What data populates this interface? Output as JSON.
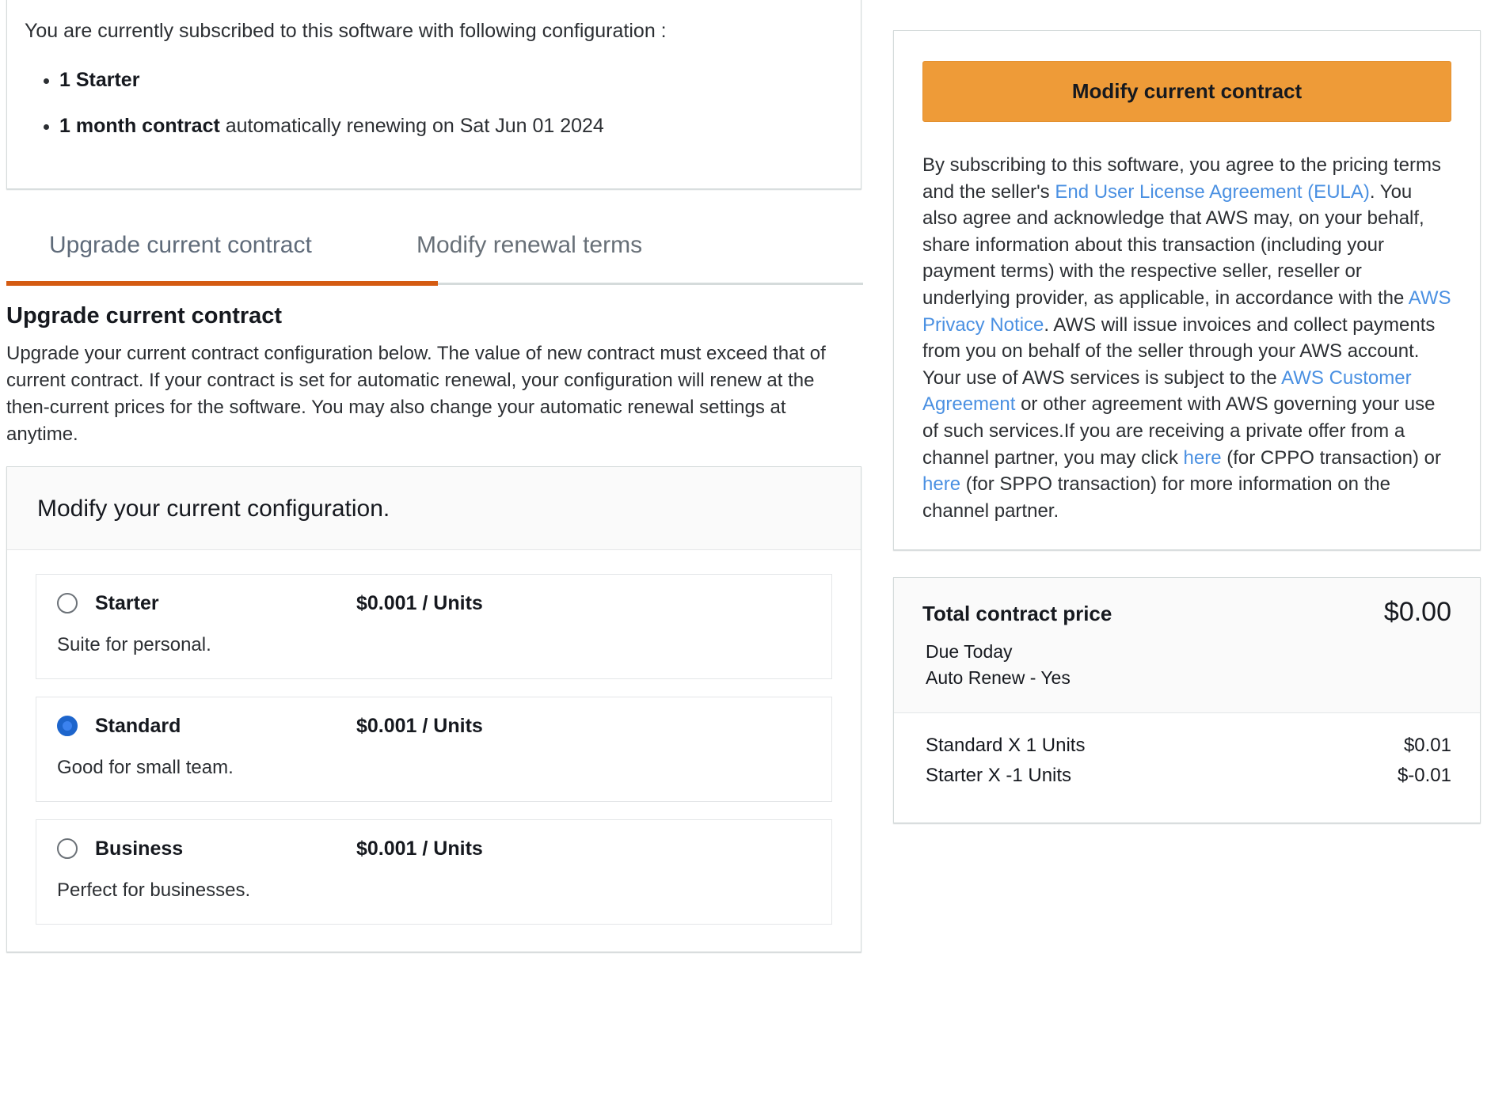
{
  "subscription": {
    "intro": "You are currently subscribed to this software with following configuration :",
    "items": [
      {
        "strong": "1 Starter",
        "rest": ""
      },
      {
        "strong": "1 month contract",
        "rest": " automatically renewing on Sat Jun 01 2024"
      }
    ]
  },
  "tabs": [
    {
      "label": "Upgrade current contract",
      "active": true
    },
    {
      "label": "Modify renewal terms",
      "active": false
    }
  ],
  "upgrade": {
    "title": "Upgrade current contract",
    "description": "Upgrade your current contract configuration below. The value of new contract must exceed that of current contract. If your contract is set for automatic renewal, your configuration will renew at the then-current prices for the software. You may also change your automatic renewal settings at anytime.",
    "config_header": "Modify your current configuration.",
    "options": [
      {
        "name": "Starter",
        "price": "$0.001 / Units",
        "desc": "Suite for personal.",
        "selected": false
      },
      {
        "name": "Standard",
        "price": "$0.001 / Units",
        "desc": "Good for small team.",
        "selected": true
      },
      {
        "name": "Business",
        "price": "$0.001 / Units",
        "desc": "Perfect for businesses.",
        "selected": false
      }
    ]
  },
  "sidebar": {
    "modify_button": "Modify current contract",
    "terms": {
      "p1": "By subscribing to this software, you agree to the pricing terms and the seller's ",
      "link_eula": "End User License Agreement (EULA)",
      "p2": ". You also agree and acknowledge that AWS may, on your behalf, share information about this transaction (including your payment terms) with the respective seller, reseller or underlying provider, as applicable, in accordance with the ",
      "link_privacy": "AWS Privacy Notice",
      "p3": ". AWS will issue invoices and collect payments from you on behalf of the seller through your AWS account. Your use of AWS services is subject to the ",
      "link_customer_agreement": "AWS Customer Agreement",
      "p4": " or other agreement with AWS governing your use of such services.If you are receiving a private offer from a channel partner, you may click ",
      "link_here_1": "here",
      "p5": " (for CPPO transaction) or ",
      "link_here_2": "here",
      "p6": " (for SPPO transaction) for more information on the channel partner."
    },
    "price": {
      "label": "Total contract price",
      "total": "$0.00",
      "due_today": "Due Today",
      "auto_renew": "Auto Renew - Yes",
      "line_items": [
        {
          "label": "Standard X 1 Units",
          "amount": "$0.01"
        },
        {
          "label": "Starter X -1 Units",
          "amount": "$-0.01"
        }
      ]
    }
  },
  "colors": {
    "accent_orange": "#ee9b38",
    "tab_underline": "#d45b12",
    "link_blue": "#4a90e2",
    "radio_selected": "#1d65cc"
  }
}
